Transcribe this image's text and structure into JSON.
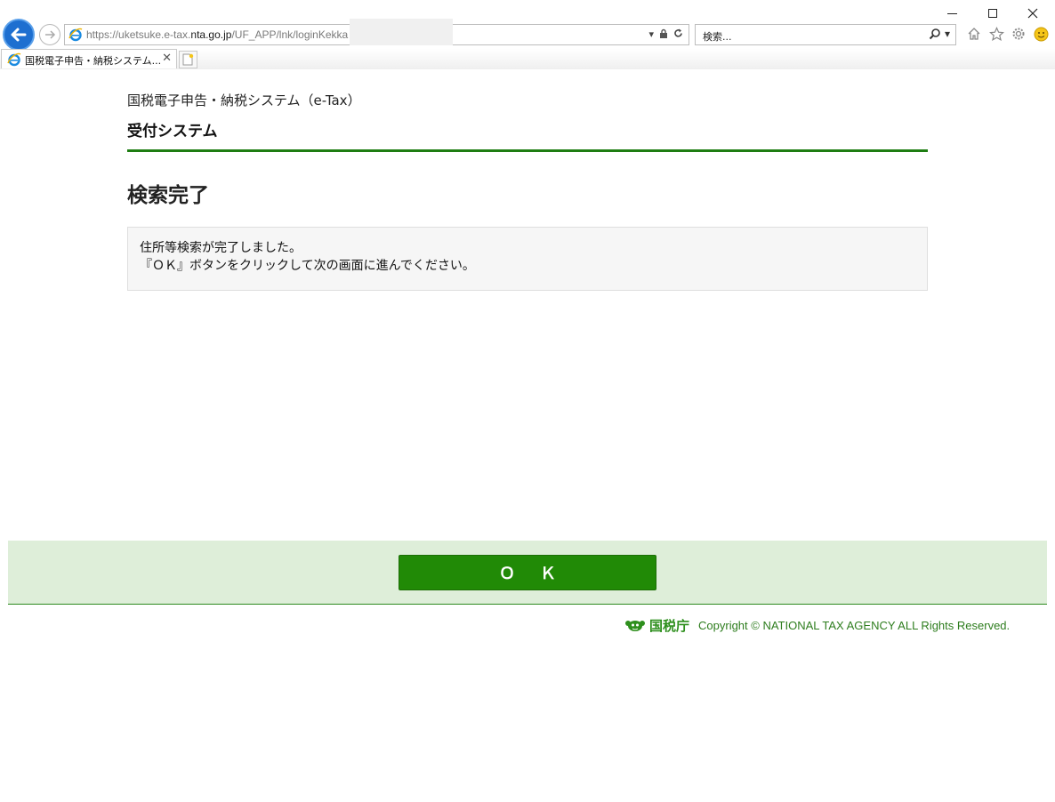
{
  "browser": {
    "url_prefix": "https://uketsuke.e-tax.",
    "url_host": "nta.go.jp",
    "url_path": "/UF_APP/lnk/loginKekka",
    "search_placeholder": "検索...",
    "tab_title": "国税電子申告・納税システム..."
  },
  "header": {
    "system_name": "国税電子申告・納税システム（e-Tax）",
    "subsystem_name": "受付システム"
  },
  "main": {
    "title": "検索完了",
    "message_line1": "住所等検索が完了しました。",
    "message_line2": "『ＯＫ』ボタンをクリックして次の画面に進んでください。"
  },
  "actions": {
    "ok_label": "ＯＫ"
  },
  "footer": {
    "logo_text": "国税庁",
    "copyright": "Copyright © NATIONAL TAX AGENCY ALL Rights Reserved."
  },
  "colors": {
    "accent_green": "#218a06",
    "band_green": "#deeed9"
  }
}
